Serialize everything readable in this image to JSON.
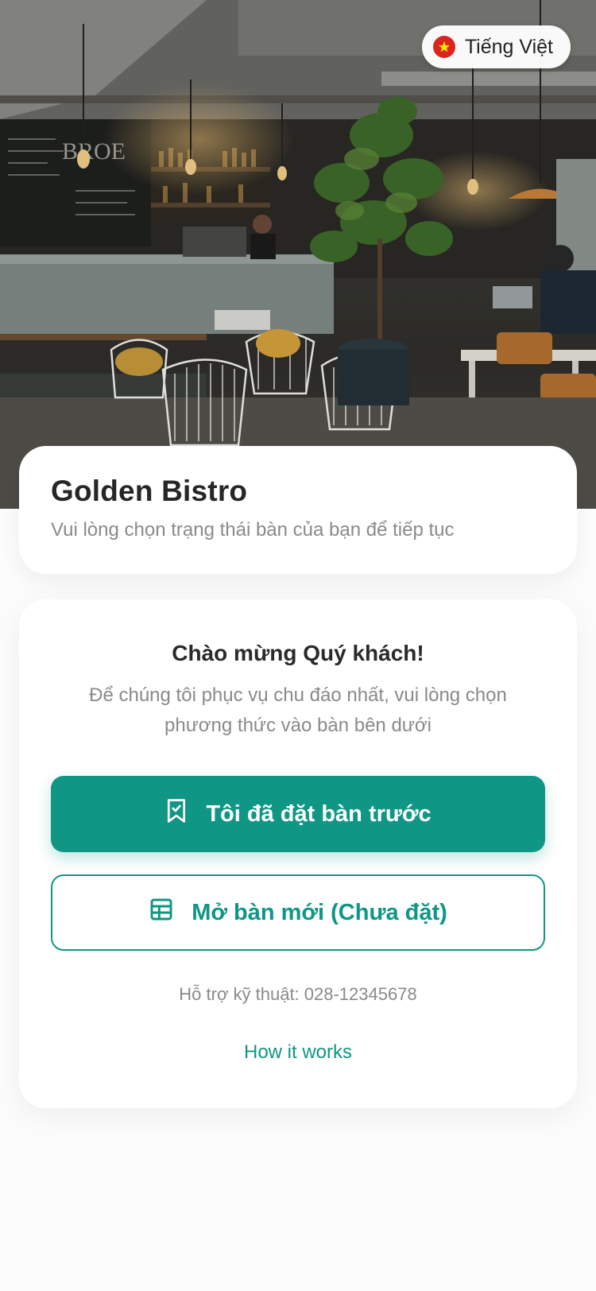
{
  "language": {
    "label": "Tiếng Việt",
    "flag_icon": "vietnam-flag-icon"
  },
  "restaurant": {
    "name": "Golden Bistro",
    "subtitle": "Vui lòng chọn trạng thái bàn của bạn để tiếp tục"
  },
  "welcome": {
    "heading": "Chào mừng Quý khách!",
    "description": "Để chúng tôi phục vụ chu đáo nhất, vui lòng chọn phương thức vào bàn bên dưới"
  },
  "actions": {
    "reserved": {
      "label": "Tôi đã đặt bàn trước",
      "icon": "bookmark-check-icon"
    },
    "new_table": {
      "label": "Mở bàn mới (Chưa đặt)",
      "icon": "table-grid-icon"
    }
  },
  "support_text": "Hỗ trợ kỹ thuật: 028-12345678",
  "how_it_works": "How it works",
  "colors": {
    "accent": "#0f9684",
    "background": "#fcfcfc",
    "flag_red": "#da251d",
    "flag_star": "#ffde00"
  }
}
